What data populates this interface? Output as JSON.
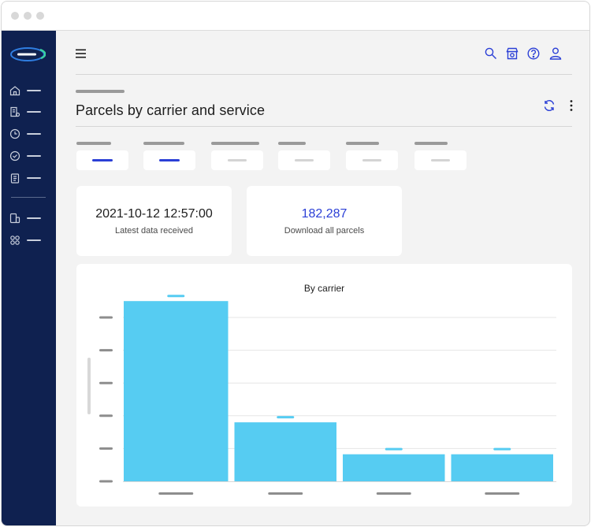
{
  "window": {
    "controls": [
      "close",
      "minimize",
      "maximize"
    ]
  },
  "sidebar": {
    "logo": "app-logo",
    "items": [
      {
        "icon": "home-icon"
      },
      {
        "icon": "document-list-icon"
      },
      {
        "icon": "clock-icon"
      },
      {
        "icon": "shield-check-icon"
      },
      {
        "icon": "clipboard-icon"
      },
      {
        "icon": "devices-icon"
      },
      {
        "icon": "apps-grid-icon"
      }
    ]
  },
  "header": {
    "icons": [
      "search-icon",
      "store-icon",
      "help-icon",
      "user-icon"
    ]
  },
  "page": {
    "title": "Parcels by carrier and service"
  },
  "filters": [
    {
      "state": "active"
    },
    {
      "state": "active"
    },
    {
      "state": "inactive"
    },
    {
      "state": "inactive"
    },
    {
      "state": "inactive"
    },
    {
      "state": "inactive"
    }
  ],
  "stats": {
    "latest": {
      "value": "2021-10-12  12:57:00",
      "label": "Latest data received"
    },
    "download": {
      "value": "182,287",
      "label": "Download all parcels"
    }
  },
  "colors": {
    "sidebar": "#0f2150",
    "accent": "#2b3fd6",
    "bar": "#56ccf2",
    "bar_label": "#56ccf2",
    "text": "#1d1d1d"
  },
  "chart_data": {
    "type": "bar",
    "title": "By carrier",
    "values": [
      110,
      36,
      16.5,
      16.5
    ],
    "ylim": [
      0,
      100
    ],
    "y_ticks": 6,
    "grid": true
  }
}
